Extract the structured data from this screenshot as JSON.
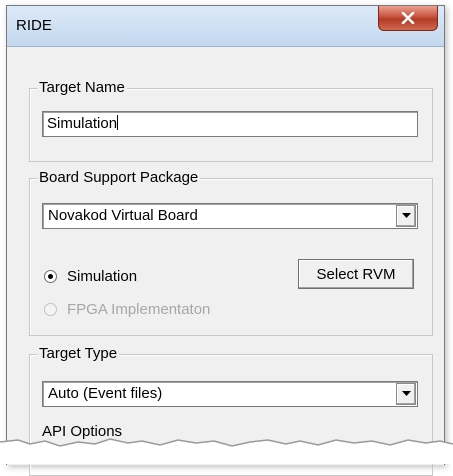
{
  "window": {
    "title": "RIDE",
    "close_icon": "close-icon"
  },
  "target_name": {
    "label": "Target Name",
    "value": "Simulation"
  },
  "bsp": {
    "label": "Board Support Package",
    "selected": "Novakod Virtual Board",
    "radio_simulation": {
      "label": "Simulation",
      "checked": true,
      "enabled": true
    },
    "radio_fpga": {
      "label": "FPGA Implementaton",
      "checked": false,
      "enabled": false
    },
    "select_rvm_label": "Select RVM"
  },
  "target_type": {
    "label": "Target Type",
    "selected": "Auto (Event files)",
    "api_options_label": "API Options"
  },
  "colors": {
    "dialog_bg": "#f0f0f0",
    "close_red": "#c9523e",
    "disabled_text": "#a7a7a7"
  }
}
